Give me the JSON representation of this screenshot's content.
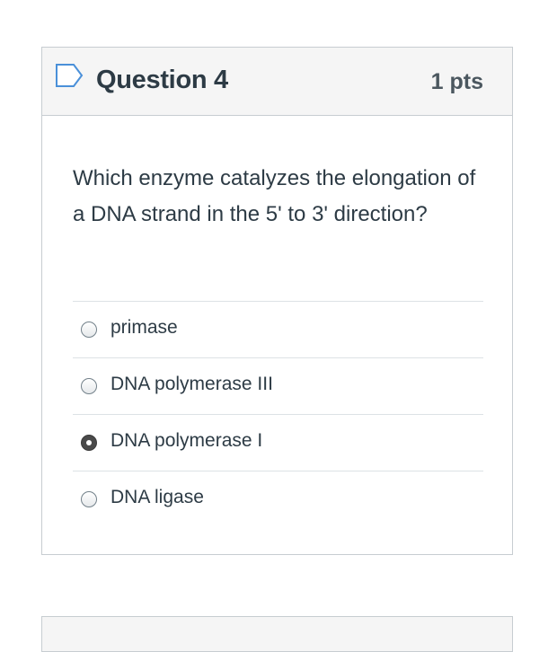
{
  "question": {
    "title": "Question 4",
    "points": "1 pts",
    "flag_icon": "flag-outline-icon",
    "text": "Which enzyme catalyzes the elongation of a DNA strand in the 5' to 3' direction?",
    "answers": [
      {
        "label": "primase",
        "selected": false
      },
      {
        "label": "DNA polymerase III",
        "selected": false
      },
      {
        "label": "DNA polymerase I",
        "selected": true
      },
      {
        "label": "DNA ligase",
        "selected": false
      }
    ]
  },
  "colors": {
    "header_bg": "#f5f5f5",
    "border": "#c7cdd1",
    "flag_stroke": "#4a90d9",
    "text": "#2d3b45"
  }
}
